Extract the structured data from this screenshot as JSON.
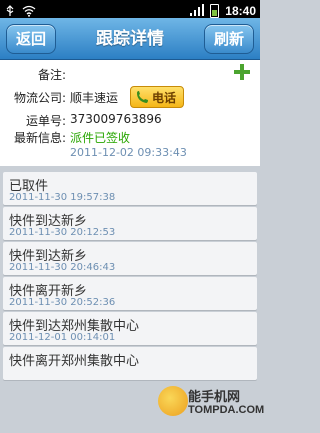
{
  "status_bar": {
    "time": "18:40",
    "icons": [
      "usb-icon",
      "wifi-icon",
      "signal-icon",
      "battery-icon"
    ]
  },
  "header": {
    "back_label": "返回",
    "title": "跟踪详情",
    "refresh_label": "刷新"
  },
  "info": {
    "note_label": "备注:",
    "note_value": "",
    "company_label": "物流公司:",
    "company_value": "顺丰速运",
    "phone_button_label": "电话",
    "tracking_label": "运单号:",
    "tracking_value": "373009763896",
    "latest_label": "最新信息:",
    "latest_value": "派件已签收",
    "latest_time": "2011-12-02 09:33:43"
  },
  "tracking_events": [
    {
      "status": "已取件",
      "time": "2011-11-30 19:57:38"
    },
    {
      "status": "快件到达新乡",
      "time": "2011-11-30 20:12:53"
    },
    {
      "status": "快件到达新乡",
      "time": "2011-11-30 20:46:43"
    },
    {
      "status": "快件离开新乡",
      "time": "2011-11-30 20:52:36"
    },
    {
      "status": "快件到达郑州集散中心",
      "time": "2011-12-01 00:14:01"
    },
    {
      "status": "快件离开郑州集散中心",
      "time": ""
    }
  ],
  "watermark": {
    "text_top": "能手机网",
    "text_bottom": "TOMPDA.COM"
  },
  "colors": {
    "header_blue": "#2c7fc4",
    "status_green": "#27a600",
    "phone_button": "#f5b618",
    "plus_green": "#4ba42f"
  }
}
